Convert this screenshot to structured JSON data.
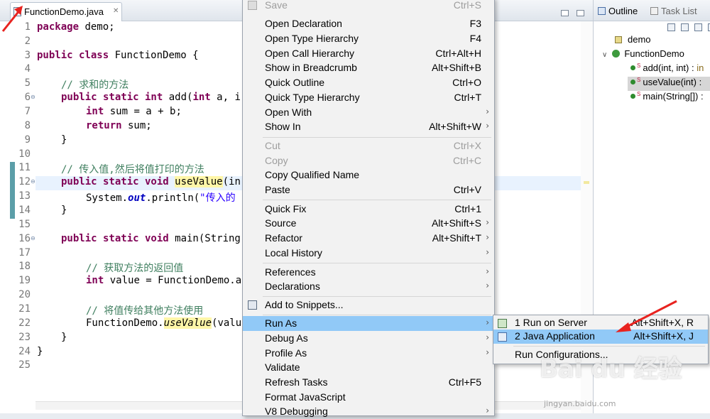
{
  "editor": {
    "tab_label": "FunctionDemo.java",
    "tab_close": "✕",
    "line_numbers": [
      "1",
      "2",
      "3",
      "4",
      "5",
      "6",
      "7",
      "8",
      "9",
      "10",
      "11",
      "12",
      "13",
      "14",
      "15",
      "16",
      "17",
      "18",
      "19",
      "20",
      "21",
      "22",
      "23",
      "24",
      "25"
    ]
  },
  "code": {
    "l1_kw": "package",
    "l1_rest": " demo;",
    "l3_kw": "public class",
    "l3_rest": " FunctionDemo {",
    "l5_cm": "// 求和的方法",
    "l6_kw1": "public static int",
    "l6_rest": " add(",
    "l6_kw2": "int",
    "l6_rest2": " a, i",
    "l7_kw": "int",
    "l7_rest": " sum = a + b;",
    "l8_kw": "return",
    "l8_rest": " sum;",
    "l9": "}",
    "l11_cm": "// 传入值,然后将值打印的方法",
    "l12_kw": "public static void",
    "l12_hl": "useValue",
    "l12_rest": "(in",
    "l13_a": "System.",
    "l13_fld": "out",
    "l13_b": ".println(",
    "l13_st": "\"传入的",
    "l14": "}",
    "l16_kw": "public static void",
    "l16_rest": " main(String",
    "l18_cm": "// 获取方法的返回值",
    "l19_kw": "int",
    "l19_rest": " value = FunctionDemo.",
    "l19_tail": "a",
    "l21_cm": "// 将值传给其他方法使用",
    "l22_a": "FunctionDemo.",
    "l22_hl": "useValue",
    "l22_b": "(valu",
    "l23": "}",
    "l24": "}"
  },
  "outline": {
    "tab_outline": "Outline",
    "tab_tasklist": "Task List",
    "package": "demo",
    "class": "FunctionDemo",
    "methods": [
      {
        "name": "add(int, int) : ",
        "type": "in"
      },
      {
        "name": "useValue(int) : ",
        "type": ""
      },
      {
        "name": "main(String[]) : ",
        "type": ""
      }
    ]
  },
  "context_menu": {
    "items": [
      {
        "label": "Save",
        "shortcut": "Ctrl+S"
      },
      {
        "label": "Open Declaration",
        "shortcut": "F3"
      },
      {
        "label": "Open Type Hierarchy",
        "shortcut": "F4"
      },
      {
        "label": "Open Call Hierarchy",
        "shortcut": "Ctrl+Alt+H"
      },
      {
        "label": "Show in Breadcrumb",
        "shortcut": "Alt+Shift+B"
      },
      {
        "label": "Quick Outline",
        "shortcut": "Ctrl+O"
      },
      {
        "label": "Quick Type Hierarchy",
        "shortcut": "Ctrl+T"
      },
      {
        "label": "Open With",
        "shortcut": ""
      },
      {
        "label": "Show In",
        "shortcut": "Alt+Shift+W"
      },
      {
        "label": "Cut",
        "shortcut": "Ctrl+X"
      },
      {
        "label": "Copy",
        "shortcut": "Ctrl+C"
      },
      {
        "label": "Copy Qualified Name",
        "shortcut": ""
      },
      {
        "label": "Paste",
        "shortcut": "Ctrl+V"
      },
      {
        "label": "Quick Fix",
        "shortcut": "Ctrl+1"
      },
      {
        "label": "Source",
        "shortcut": "Alt+Shift+S"
      },
      {
        "label": "Refactor",
        "shortcut": "Alt+Shift+T"
      },
      {
        "label": "Local History",
        "shortcut": ""
      },
      {
        "label": "References",
        "shortcut": ""
      },
      {
        "label": "Declarations",
        "shortcut": ""
      },
      {
        "label": "Add to Snippets...",
        "shortcut": ""
      },
      {
        "label": "Run As",
        "shortcut": ""
      },
      {
        "label": "Debug As",
        "shortcut": ""
      },
      {
        "label": "Profile As",
        "shortcut": ""
      },
      {
        "label": "Validate",
        "shortcut": ""
      },
      {
        "label": "Refresh Tasks",
        "shortcut": "Ctrl+F5"
      },
      {
        "label": "Format JavaScript",
        "shortcut": ""
      },
      {
        "label": "V8 Debugging",
        "shortcut": ""
      }
    ],
    "arrow": "›"
  },
  "submenu": {
    "items": [
      {
        "label": "1 Run on Server",
        "shortcut": "Alt+Shift+X, R"
      },
      {
        "label": "2 Java Application",
        "shortcut": "Alt+Shift+X, J"
      },
      {
        "label": "Run Configurations...",
        "shortcut": ""
      }
    ]
  },
  "watermark": {
    "logo": "Bai du 经验",
    "url": "jingyan.baidu.com"
  },
  "colors": {
    "menu_highlight": "#91c9f7",
    "annotation_arrow": "#e8231f",
    "keyword": "#7f0055",
    "comment": "#3f7f5f"
  }
}
